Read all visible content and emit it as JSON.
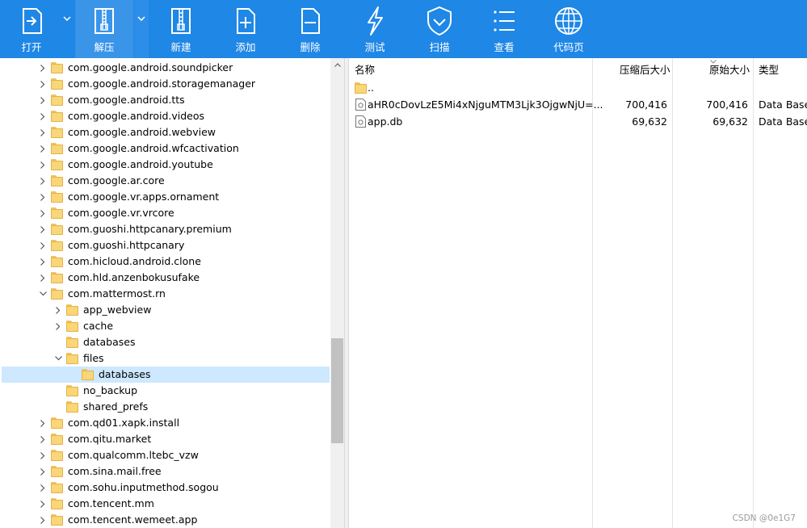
{
  "toolbar": {
    "buttons": [
      {
        "label": "打开",
        "icon": "open-icon"
      },
      {
        "label": "解压",
        "icon": "extract-icon"
      },
      {
        "label": "新建",
        "icon": "new-archive-icon"
      },
      {
        "label": "添加",
        "icon": "add-file-icon"
      },
      {
        "label": "删除",
        "icon": "delete-file-icon"
      },
      {
        "label": "测试",
        "icon": "test-icon"
      },
      {
        "label": "扫描",
        "icon": "scan-shield-icon"
      },
      {
        "label": "查看",
        "icon": "view-list-icon"
      },
      {
        "label": "代码页",
        "icon": "globe-icon"
      }
    ],
    "accent": "#1f87e6"
  },
  "tree": {
    "items": [
      {
        "label": "com.google.android.soundpicker",
        "expander": "collapsed"
      },
      {
        "label": "com.google.android.storagemanager",
        "expander": "collapsed"
      },
      {
        "label": "com.google.android.tts",
        "expander": "collapsed"
      },
      {
        "label": "com.google.android.videos",
        "expander": "collapsed"
      },
      {
        "label": "com.google.android.webview",
        "expander": "collapsed"
      },
      {
        "label": "com.google.android.wfcactivation",
        "expander": "collapsed"
      },
      {
        "label": "com.google.android.youtube",
        "expander": "collapsed"
      },
      {
        "label": "com.google.ar.core",
        "expander": "collapsed"
      },
      {
        "label": "com.google.vr.apps.ornament",
        "expander": "collapsed"
      },
      {
        "label": "com.google.vr.vrcore",
        "expander": "collapsed"
      },
      {
        "label": "com.guoshi.httpcanary.premium",
        "expander": "collapsed"
      },
      {
        "label": "com.guoshi.httpcanary",
        "expander": "collapsed"
      },
      {
        "label": "com.hicloud.android.clone",
        "expander": "collapsed"
      },
      {
        "label": "com.hld.anzenbokusufake",
        "expander": "collapsed"
      },
      {
        "label": "com.mattermost.rn",
        "expander": "expanded"
      },
      {
        "label": "app_webview",
        "expander": "collapsed"
      },
      {
        "label": "cache",
        "expander": "collapsed"
      },
      {
        "label": "databases",
        "expander": "none"
      },
      {
        "label": "files",
        "expander": "expanded"
      },
      {
        "label": "databases",
        "expander": "none",
        "selected": true
      },
      {
        "label": "no_backup",
        "expander": "none"
      },
      {
        "label": "shared_prefs",
        "expander": "none"
      },
      {
        "label": "com.qd01.xapk.install",
        "expander": "collapsed"
      },
      {
        "label": "com.qitu.market",
        "expander": "collapsed"
      },
      {
        "label": "com.qualcomm.ltebc_vzw",
        "expander": "collapsed"
      },
      {
        "label": "com.sina.mail.free",
        "expander": "collapsed"
      },
      {
        "label": "com.sohu.inputmethod.sogou",
        "expander": "collapsed"
      },
      {
        "label": "com.tencent.mm",
        "expander": "collapsed"
      },
      {
        "label": "com.tencent.wemeet.app",
        "expander": "collapsed"
      }
    ]
  },
  "filelist": {
    "headers": {
      "name": "名称",
      "packed": "压缩后大小",
      "size": "原始大小",
      "type": "类型"
    },
    "parent": "..",
    "files": [
      {
        "name": "aHR0cDovLzE5Mi4xNjguMTM3Ljk3OjgwNjU=...",
        "packed": "700,416",
        "size": "700,416",
        "type": "Data Base"
      },
      {
        "name": "app.db",
        "packed": "69,632",
        "size": "69,632",
        "type": "Data Base"
      }
    ]
  },
  "watermark": "CSDN @0e1G7"
}
